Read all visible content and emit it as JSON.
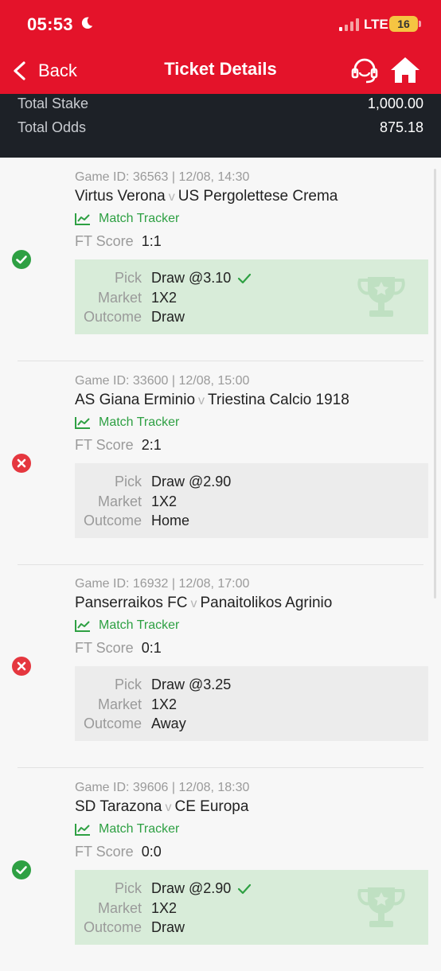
{
  "status_bar": {
    "time": "05:53",
    "network": "LTE",
    "battery": "16"
  },
  "nav": {
    "back_label": "Back",
    "title": "Ticket Details"
  },
  "summary": {
    "stake_label": "Total Stake",
    "stake_value": "1,000.00",
    "odds_label": "Total Odds",
    "odds_value": "875.18"
  },
  "labels": {
    "tracker": "Match Tracker",
    "ft_score": "FT Score",
    "pick": "Pick",
    "market": "Market",
    "outcome": "Outcome",
    "vs": "v"
  },
  "games": [
    {
      "game_id_line": "Game ID: 36563 | 12/08, 14:30",
      "home": "Virtus Verona",
      "away": "US Pergolettese Crema",
      "ft_score": "1:1",
      "pick": "Draw @3.10",
      "market": "1X2",
      "outcome": "Draw",
      "result": "won"
    },
    {
      "game_id_line": "Game ID: 33600 | 12/08, 15:00",
      "home": "AS Giana Erminio",
      "away": "Triestina Calcio 1918",
      "ft_score": "2:1",
      "pick": "Draw @2.90",
      "market": "1X2",
      "outcome": "Home",
      "result": "lost"
    },
    {
      "game_id_line": "Game ID: 16932 | 12/08, 17:00",
      "home": "Panserraikos FC",
      "away": "Panaitolikos Agrinio",
      "ft_score": "0:1",
      "pick": "Draw @3.25",
      "market": "1X2",
      "outcome": "Away",
      "result": "lost"
    },
    {
      "game_id_line": "Game ID: 39606 | 12/08, 18:30",
      "home": "SD Tarazona",
      "away": "CE Europa",
      "ft_score": "0:0",
      "pick": "Draw @2.90",
      "market": "1X2",
      "outcome": "Draw",
      "result": "won"
    }
  ],
  "colors": {
    "brand": "#e4132a",
    "win": "#2ea043",
    "loss": "#e5373f",
    "win_bg": "#d8ecd9",
    "loss_bg": "#ececec"
  }
}
